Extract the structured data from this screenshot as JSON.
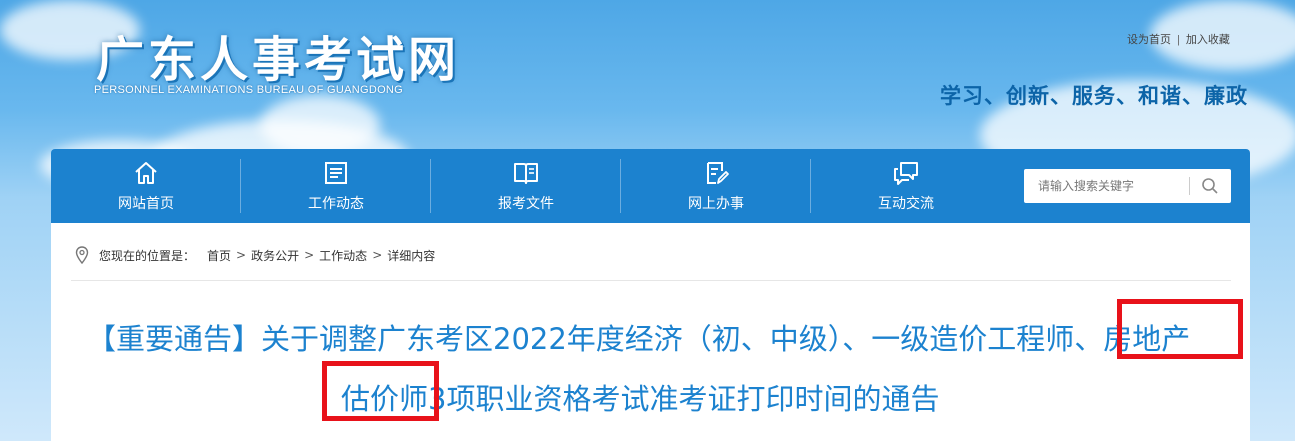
{
  "header": {
    "logo_cn": "广东人事考试网",
    "logo_en": "PERSONNEL EXAMINATIONS BUREAU OF GUANGDONG",
    "top_links": {
      "homepage": "设为首页",
      "separator": "|",
      "bookmark": "加入收藏"
    },
    "slogan": "学习、创新、服务、和谐、廉政"
  },
  "nav": {
    "items": [
      {
        "label": "网站首页",
        "icon": "home-icon"
      },
      {
        "label": "工作动态",
        "icon": "news-icon"
      },
      {
        "label": "报考文件",
        "icon": "document-icon"
      },
      {
        "label": "网上办事",
        "icon": "edit-icon"
      },
      {
        "label": "互动交流",
        "icon": "chat-icon"
      }
    ],
    "search": {
      "placeholder": "请输入搜索关键字",
      "value": "",
      "icon": "search-icon"
    }
  },
  "breadcrumb": {
    "label": "您现在的位置是：",
    "icon": "location-pin-icon",
    "items": [
      "首页",
      "政务公开",
      "工作动态",
      "详细内容"
    ],
    "separator": ">"
  },
  "article": {
    "title_line1": "【重要通告】关于调整广东考区2022年度经济（初、中级）、一级造价工程师、房地产",
    "title_line2": "估价师3项职业资格考试准考证打印时间的通告"
  },
  "colors": {
    "nav_bg": "#1c82cf",
    "title": "#1c82cf",
    "slogan": "#0c64a8",
    "highlight": "#e8121a"
  }
}
